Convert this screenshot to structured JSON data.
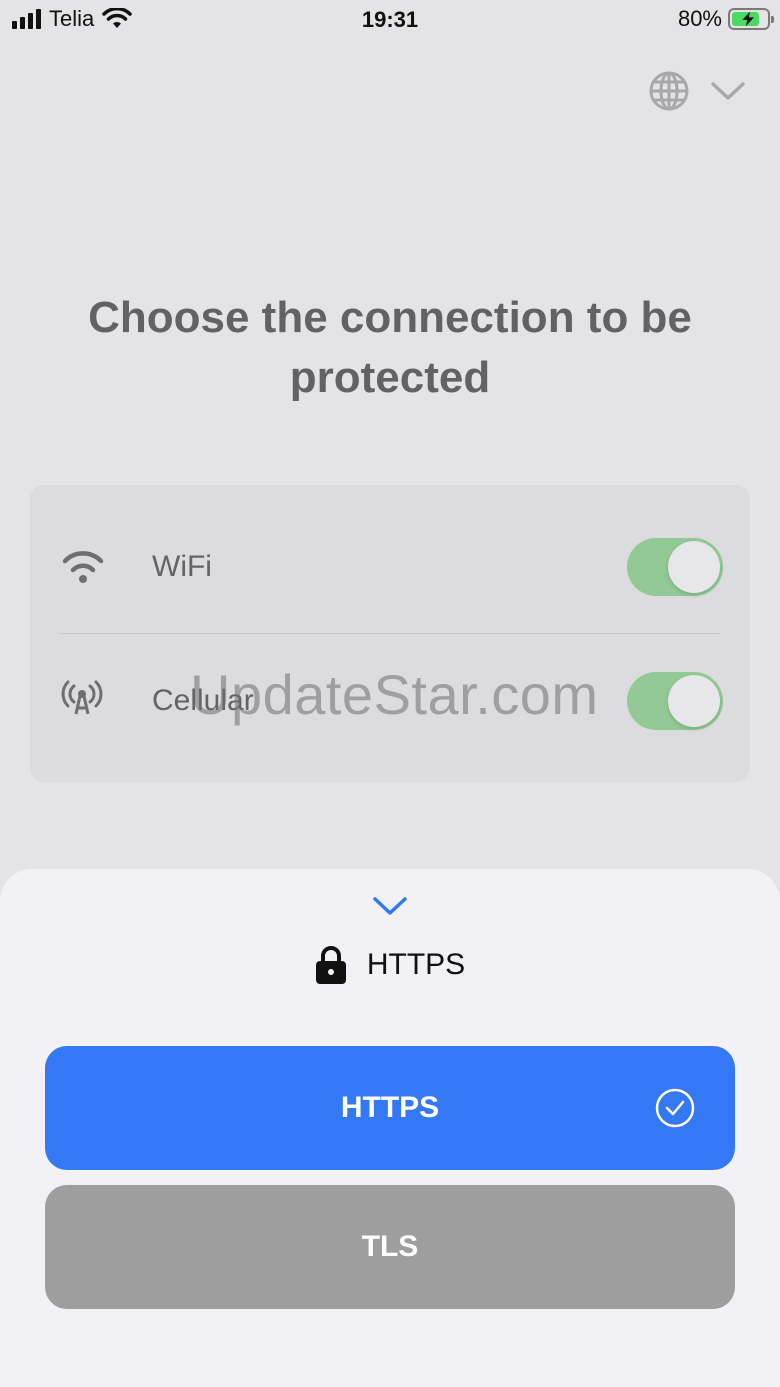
{
  "status_bar": {
    "carrier": "Telia",
    "time": "19:31",
    "battery": "80%",
    "battery_level": 0.8
  },
  "language_selector": {
    "icon": "globe-icon",
    "chevron": "chevron-down-icon"
  },
  "title": "Choose the connection to be protected",
  "connections": [
    {
      "label": "WiFi",
      "icon": "wifi-icon",
      "enabled": true
    },
    {
      "label": "Cellular",
      "icon": "cellular-antenna-icon",
      "enabled": true
    }
  ],
  "watermark": "UpdateStar.com",
  "sheet": {
    "selected_protocol": "HTTPS",
    "options": [
      {
        "label": "HTTPS",
        "selected": true
      },
      {
        "label": "TLS",
        "selected": false
      }
    ]
  },
  "colors": {
    "accent": "#3478f6",
    "toggle_on": "#92c995",
    "option_inactive": "#9e9e9e"
  }
}
